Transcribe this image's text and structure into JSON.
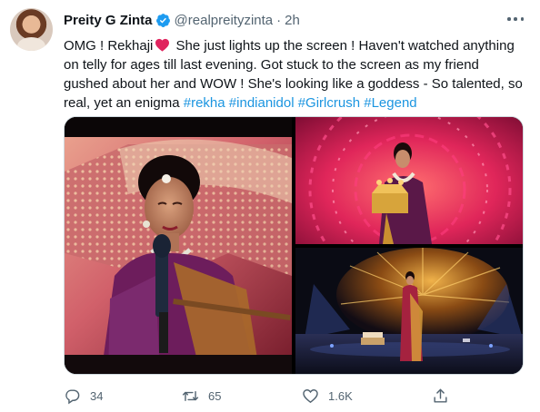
{
  "author": {
    "display_name": "Preity G Zinta",
    "handle": "@realpreityzinta",
    "separator": "·",
    "time": "2h"
  },
  "tweet": {
    "text_before_heart": "OMG ! Rekhaji",
    "text_after_heart": " She just lights up the screen ! Haven't watched anything on telly for ages till last evening. Got stuck to the screen as my friend gushed about her and WOW ! She's looking like a goddess - So talented, so real, yet an enigma ",
    "hashtags": [
      "#rekha",
      "#indianidol",
      "#Girlcrush",
      "#Legend"
    ]
  },
  "actions": {
    "reply_count": "34",
    "retweet_count": "65",
    "like_count": "1.6K"
  },
  "colors": {
    "link": "#1b95e0",
    "secondary_text": "#536471",
    "verified": "#1d9bf0",
    "heart": "#e0245e"
  }
}
